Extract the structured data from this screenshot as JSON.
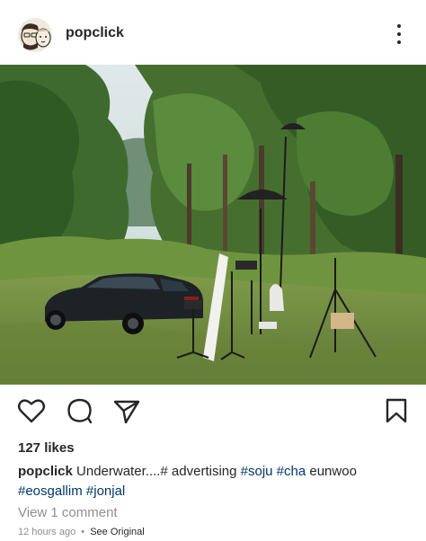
{
  "post": {
    "username": "popclick",
    "likes": "127 likes",
    "caption": {
      "username": "popclick",
      "text1": "Underwater....# advertising",
      "tag1": "#soju",
      "tag2": "#cha",
      "text2": "eunwoo",
      "tag3": "#eosgallim",
      "tag4": "#jonjal"
    },
    "view_comments": "View 1 comment",
    "time_ago": "12 hours ago",
    "separator": "•",
    "see_original": "See Original"
  },
  "icons": {
    "header_more": "more-vertical-icon",
    "like": "heart-icon",
    "comment": "comment-bubble-icon",
    "share": "paper-plane-icon",
    "save": "bookmark-icon"
  },
  "colors": {
    "text": "#262626",
    "secondary": "#8e8e8e",
    "hashtag": "#00376b",
    "background": "#ffffff"
  }
}
